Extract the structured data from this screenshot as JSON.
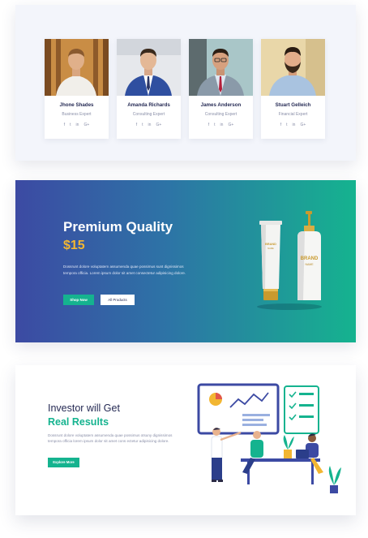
{
  "team": {
    "members": [
      {
        "name": "Jhone Shades",
        "role": "Business Expert"
      },
      {
        "name": "Amanda Richards",
        "role": "Consulting Expert"
      },
      {
        "name": "James Anderson",
        "role": "Consulting Expert"
      },
      {
        "name": "Stuart Gelleich",
        "role": "Financial Expert"
      }
    ],
    "social_icons": [
      "f",
      "t",
      "in",
      "G+"
    ]
  },
  "promo": {
    "title": "Premium Quality",
    "price": "$15",
    "description": "Dossrunt dolore voluptatem assumenda quae possimus sunt dignissimos tempora officia. Lorem ipsum dolor sit amet consectetur adipisicing dolore.",
    "shop_button": "Shop Now",
    "all_products_button": "All Products",
    "brand_label": "BRAND",
    "brand_sub": "NAME",
    "colors": {
      "gradient_start": "#3c4aa3",
      "gradient_end": "#15b38f",
      "price": "#f2b632"
    }
  },
  "investor": {
    "title_line1": "Investor will Get",
    "title_line2": "Real Results",
    "description": "Dossrunt dolore voluptatem assumenda quae possimus otsuny dignissimos tempora officia lorem ipsum dolor sit amet cons ectetur adipisicing dolore.",
    "button": "Explore More",
    "accent": "#15b38f"
  }
}
